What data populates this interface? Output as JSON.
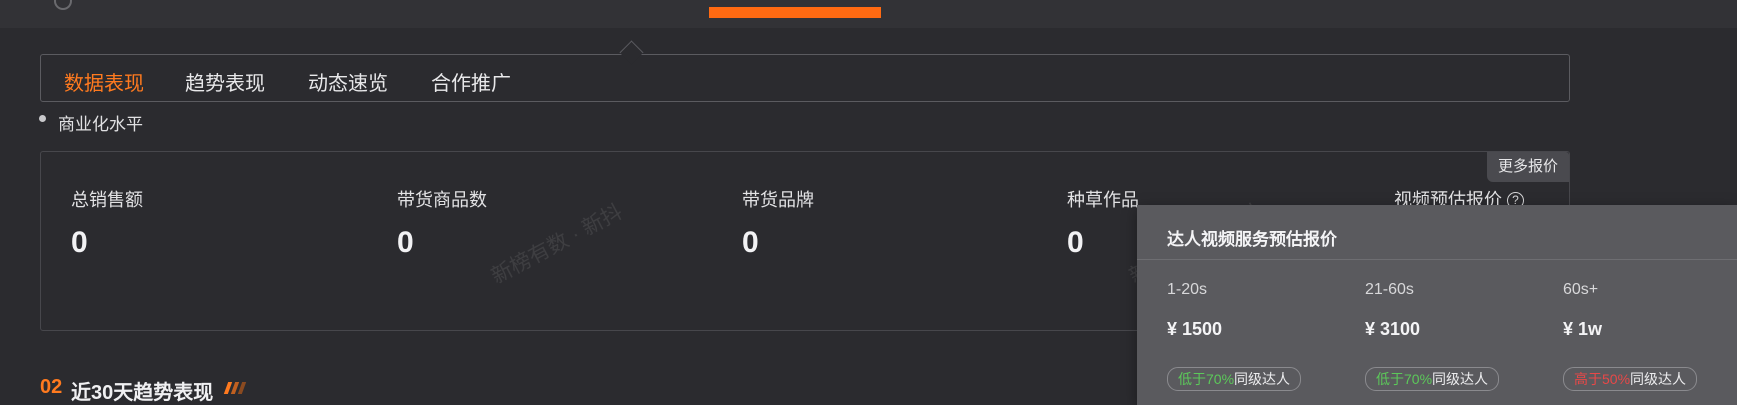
{
  "tabs": [
    "数据表现",
    "趋势表现",
    "动态速览",
    "合作推广"
  ],
  "section": {
    "label": "商业化水平"
  },
  "more_button": "更多报价",
  "stats": [
    {
      "label": "总销售额",
      "value": "0"
    },
    {
      "label": "带货商品数",
      "value": "0"
    },
    {
      "label": "带货品牌",
      "value": "0"
    },
    {
      "label": "种草作品",
      "value": "0"
    },
    {
      "label": "视频预估报价",
      "value": ""
    }
  ],
  "watermark": "新榜有数 · 新抖",
  "section2": {
    "number": "02",
    "title": "近30天趋势表现"
  },
  "popup": {
    "title": "达人视频服务预估报价",
    "prices": [
      {
        "duration": "1-20s",
        "price": "¥ 1500",
        "compare_prefix": "低于70%",
        "compare_suffix": "同级达人",
        "trend": "low"
      },
      {
        "duration": "21-60s",
        "price": "¥ 3100",
        "compare_prefix": "低于70%",
        "compare_suffix": "同级达人",
        "trend": "low"
      },
      {
        "duration": "60s+",
        "price": "¥ 1w",
        "compare_prefix": "高于50%",
        "compare_suffix": "同级达人",
        "trend": "high"
      }
    ]
  },
  "colors": {
    "accent": "#ff7a1f",
    "background": "#2b2b2f",
    "positive": "#5cc85a",
    "negative": "#e84848"
  }
}
